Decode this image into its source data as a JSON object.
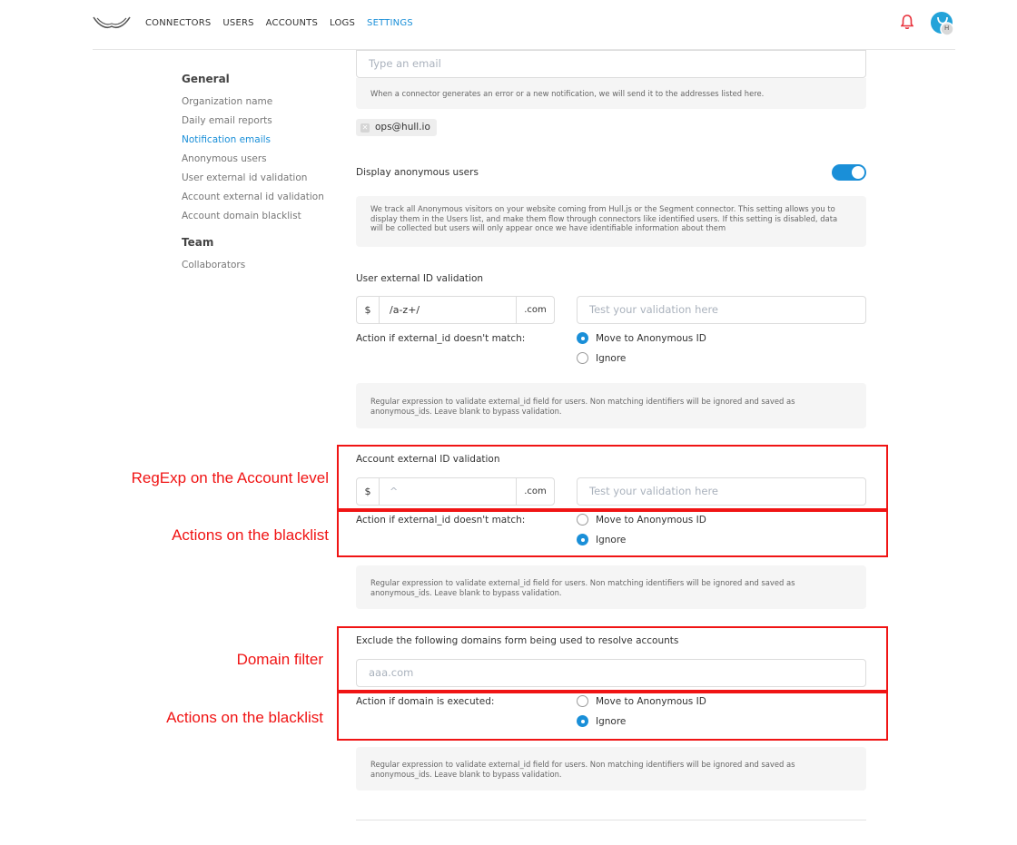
{
  "nav": {
    "links": [
      {
        "label": "CONNECTORS"
      },
      {
        "label": "USERS"
      },
      {
        "label": "ACCOUNTS"
      },
      {
        "label": "LOGS"
      },
      {
        "label": "SETTINGS",
        "active": true
      }
    ],
    "avatar_initial": "H",
    "icons": {
      "logo": "hull-logo",
      "bell": "bell-icon",
      "avatar": "avatar"
    },
    "colors": {
      "accent": "#1a8fd8",
      "bell": "#e8323c"
    }
  },
  "sidebar": {
    "general_heading": "General",
    "general_items": [
      {
        "label": "Organization name"
      },
      {
        "label": "Daily email reports"
      },
      {
        "label": "Notification emails",
        "active": true
      },
      {
        "label": "Anonymous users"
      },
      {
        "label": "User external id validation"
      },
      {
        "label": "Account external id validation"
      },
      {
        "label": "Account domain blacklist"
      }
    ],
    "team_heading": "Team",
    "team_items": [
      {
        "label": "Collaborators"
      }
    ]
  },
  "notification_emails": {
    "placeholder": "Type an email",
    "help": "When a connector generates an error or a new notification, we will send it to the addresses listed here.",
    "emails": [
      "ops@hull.io"
    ]
  },
  "anonymous_users": {
    "label": "Display anonymous users",
    "enabled": true,
    "help": "We track all Anonymous visitors on your website coming from Hull.js or the Segment connector. This setting allows you to display them in the Users list, and make them flow through connectors like identified users. If this setting is disabled, data will be collected but users will only appear once we have identifiable information about them"
  },
  "user_validation": {
    "label": "User external ID validation",
    "prefix": "$",
    "value": "/a-z+/",
    "suffix": ".com",
    "test_placeholder": "Test your validation here",
    "action_label": "Action if external_id doesn't match:",
    "options": [
      "Move to Anonymous ID",
      "Ignore"
    ],
    "selected": "Move to Anonymous ID",
    "help": "Regular expression to validate external_id field for users. Non matching identifiers will be ignored and saved as anonymous_ids. Leave blank to bypass validation."
  },
  "account_validation": {
    "label": "Account external ID validation",
    "prefix": "$",
    "value": "^",
    "suffix": ".com",
    "test_placeholder": "Test your validation here",
    "action_label": "Action if external_id doesn't match:",
    "options": [
      "Move to Anonymous ID",
      "Ignore"
    ],
    "selected": "Ignore",
    "help": "Regular expression to validate external_id field for users. Non matching identifiers will be ignored and saved as anonymous_ids. Leave blank to bypass validation."
  },
  "domain_blacklist": {
    "label": "Exclude the following domains form being used to resolve accounts",
    "placeholder": "aaa.com",
    "action_label": "Action if domain is executed:",
    "options": [
      "Move to Anonymous ID",
      "Ignore"
    ],
    "selected": "Ignore",
    "help": "Regular expression to validate external_id field for users. Non matching identifiers will be ignored and saved as anonymous_ids. Leave blank to bypass validation."
  },
  "annotations": {
    "regexp": "RegExp on the Account level",
    "actions_1": "Actions on the blacklist",
    "domain_filter": "Domain filter",
    "actions_2": "Actions on the blacklist",
    "color": "#f01414"
  }
}
